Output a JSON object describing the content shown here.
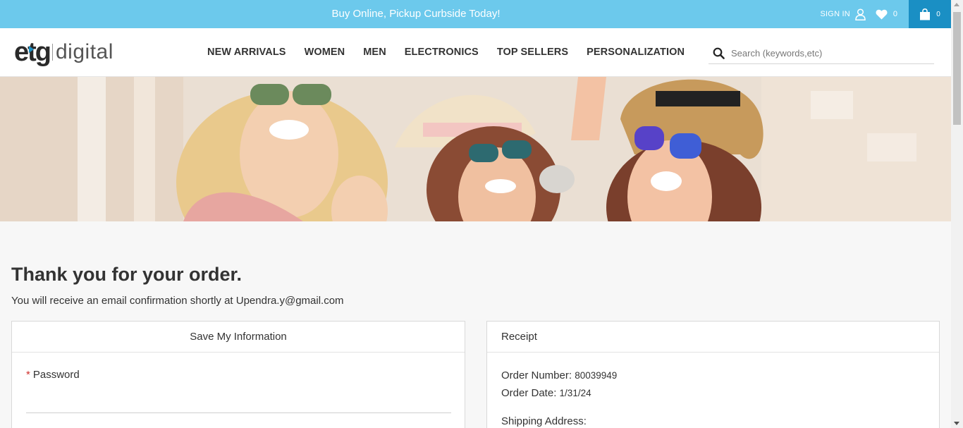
{
  "promo": {
    "text": "Buy Online, Pickup Curbside Today!",
    "signin_label": "SIGN IN",
    "wishlist_count": "0",
    "cart_count": "0"
  },
  "brand": {
    "logo_primary": "etg",
    "logo_secondary": "digital"
  },
  "nav": {
    "items": [
      "NEW ARRIVALS",
      "WOMEN",
      "MEN",
      "ELECTRONICS",
      "TOP SELLERS",
      "PERSONALIZATION"
    ]
  },
  "search": {
    "placeholder": "Search (keywords,etc)",
    "icon": "search-icon"
  },
  "confirmation": {
    "title": "Thank you for your order.",
    "email_note": "You will receive an email confirmation shortly at Upendra.y@gmail.com"
  },
  "save_info": {
    "heading": "Save My Information",
    "required_mark": "*",
    "password_label": "Password"
  },
  "receipt": {
    "heading": "Receipt",
    "order_number_label": "Order Number:",
    "order_number": "80039949",
    "order_date_label": "Order Date:",
    "order_date": "1/31/24",
    "shipping_label": "Shipping Address:"
  },
  "colors": {
    "promo_bar": "#6cc9ec",
    "cart_button": "#1a8fc4",
    "required": "#d0312d"
  }
}
